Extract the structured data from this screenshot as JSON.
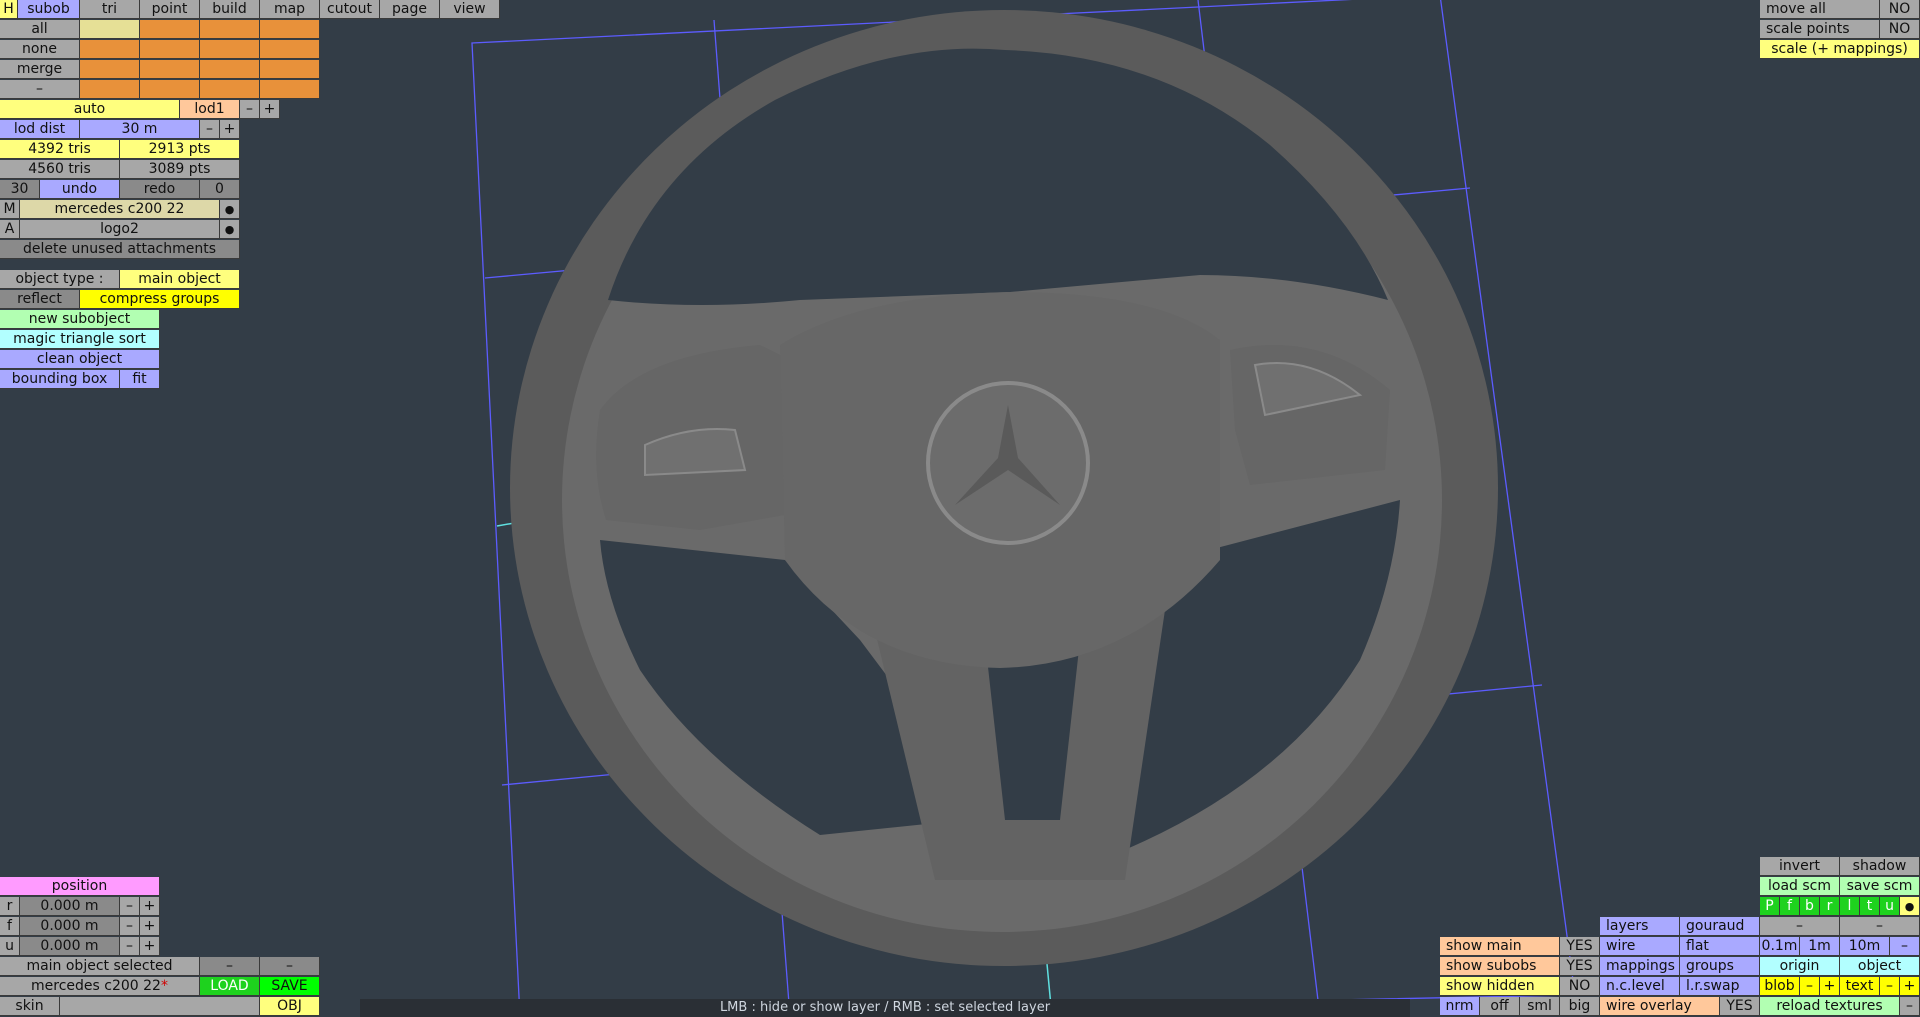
{
  "menu": {
    "h": "H",
    "tabs": [
      "subob",
      "tri",
      "point",
      "build",
      "map",
      "cutout",
      "page",
      "view"
    ]
  },
  "selection": {
    "all": "all",
    "none": "none",
    "merge": "merge",
    "minus": "–"
  },
  "lod": {
    "auto": "auto",
    "lod1": "lod1",
    "minus": "–",
    "plus": "+"
  },
  "lod_dist": {
    "label": "lod dist",
    "value": "30 m",
    "minus": "–",
    "plus": "+"
  },
  "stats": {
    "tris1": "4392 tris",
    "pts1": "2913 pts",
    "tris2": "4560 tris",
    "pts2": "3089 pts"
  },
  "history": {
    "count": "30",
    "undo": "undo",
    "redo": "redo",
    "redo_count": "0"
  },
  "material": {
    "m": "M",
    "name": "mercedes c200 22",
    "dot": "●"
  },
  "attachment": {
    "a": "A",
    "name": "logo2",
    "dot": "●"
  },
  "delete_unused": "delete unused attachments",
  "object_type": {
    "label": "object type :",
    "value": "main object"
  },
  "reflect": "reflect",
  "compress_groups": "compress groups",
  "new_subobject": "new subobject",
  "magic_sort": "magic triangle sort",
  "clean_object": "clean object",
  "bounding_box": {
    "label": "bounding box",
    "fit": "fit"
  },
  "position": {
    "title": "position",
    "rows": [
      {
        "axis": "r",
        "value": "0.000 m"
      },
      {
        "axis": "f",
        "value": "0.000 m"
      },
      {
        "axis": "u",
        "value": "0.000 m"
      }
    ],
    "minus": "–",
    "plus": "+"
  },
  "bottom_left": {
    "selected": "main object selected",
    "minus": "–",
    "file_name": "mercedes c200 22",
    "modified_mark": "*",
    "load": "LOAD",
    "save": "SAVE",
    "skin": "skin",
    "obj": "OBJ"
  },
  "top_right": {
    "move_all": "move all",
    "move_all_val": "NO",
    "scale_points": "scale points",
    "scale_points_val": "NO",
    "scale_mappings": "scale (+ mappings)"
  },
  "bottom_right": {
    "invert": "invert",
    "shadow": "shadow",
    "load_scm": "load scm",
    "save_scm": "save scm",
    "views": [
      "P",
      "f",
      "b",
      "r",
      "l",
      "t",
      "u"
    ],
    "views_dot": "●",
    "layers": "layers",
    "gouraud": "gouraud",
    "dash": "–",
    "show_main": "show main",
    "show_main_val": "YES",
    "wire": "wire",
    "flat": "flat",
    "grid": [
      "0.1m",
      "1m",
      "10m",
      "–"
    ],
    "show_subobs": "show subobs",
    "show_subobs_val": "YES",
    "mappings": "mappings",
    "groups": "groups",
    "origin": "origin",
    "object": "object",
    "show_hidden": "show hidden",
    "show_hidden_val": "NO",
    "nc_level": "n.c.level",
    "lr_swap": "l.r.swap",
    "blob": "blob",
    "text": "text",
    "nrm": "nrm",
    "off": "off",
    "sml": "sml",
    "big": "big",
    "wire_overlay": "wire overlay",
    "wire_overlay_val": "YES",
    "reload_textures": "reload textures"
  },
  "status_bar": "LMB : hide or show layer / RMB : set selected layer",
  "colors": {
    "background": "#333d47",
    "grid": "#5c5cff",
    "axis": "#5fe0e0",
    "model": "#5b5b5b"
  }
}
